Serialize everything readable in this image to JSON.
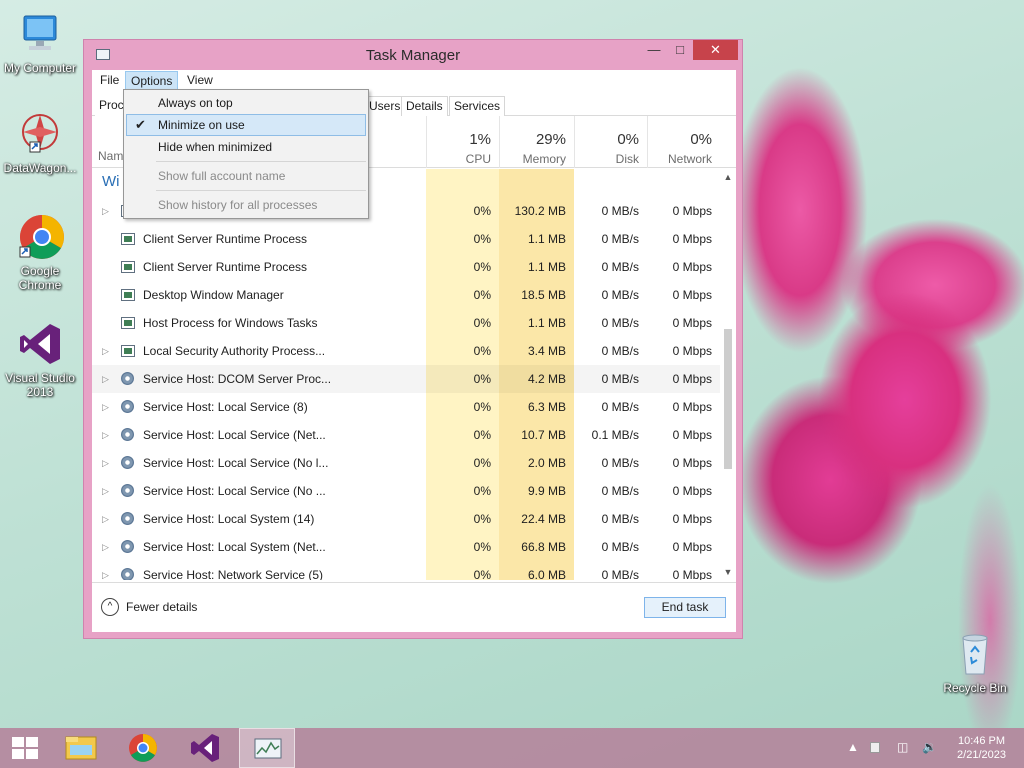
{
  "desktop": {
    "icons": [
      {
        "label": "My Computer"
      },
      {
        "label": "DataWagon..."
      },
      {
        "label": "Google Chrome"
      },
      {
        "label": "Visual Studio 2013"
      },
      {
        "label": "Recycle Bin"
      }
    ]
  },
  "window": {
    "title": "Task Manager",
    "menu": [
      "File",
      "Options",
      "View"
    ],
    "tabs": [
      "Proc",
      "Users",
      "Details",
      "Services"
    ],
    "columns": {
      "name": "Nam",
      "cpu": {
        "pct": "1%",
        "label": "CPU"
      },
      "memory": {
        "pct": "29%",
        "label": "Memory"
      },
      "disk": {
        "pct": "0%",
        "label": "Disk"
      },
      "network": {
        "pct": "0%",
        "label": "Network"
      }
    },
    "group_heading": "Wi",
    "processes": [
      {
        "name": "",
        "cpu": "0%",
        "memory": "130.2 MB",
        "disk": "0 MB/s",
        "network": "0 Mbps"
      },
      {
        "name": "Client Server Runtime Process",
        "cpu": "0%",
        "memory": "1.1 MB",
        "disk": "0 MB/s",
        "network": "0 Mbps"
      },
      {
        "name": "Client Server Runtime Process",
        "cpu": "0%",
        "memory": "1.1 MB",
        "disk": "0 MB/s",
        "network": "0 Mbps"
      },
      {
        "name": "Desktop Window Manager",
        "cpu": "0%",
        "memory": "18.5 MB",
        "disk": "0 MB/s",
        "network": "0 Mbps"
      },
      {
        "name": "Host Process for Windows Tasks",
        "cpu": "0%",
        "memory": "1.1 MB",
        "disk": "0 MB/s",
        "network": "0 Mbps"
      },
      {
        "name": "Local Security Authority Process...",
        "cpu": "0%",
        "memory": "3.4 MB",
        "disk": "0 MB/s",
        "network": "0 Mbps"
      },
      {
        "name": "Service Host: DCOM Server Proc...",
        "cpu": "0%",
        "memory": "4.2 MB",
        "disk": "0 MB/s",
        "network": "0 Mbps"
      },
      {
        "name": "Service Host: Local Service (8)",
        "cpu": "0%",
        "memory": "6.3 MB",
        "disk": "0 MB/s",
        "network": "0 Mbps"
      },
      {
        "name": "Service Host: Local Service (Net...",
        "cpu": "0%",
        "memory": "10.7 MB",
        "disk": "0.1 MB/s",
        "network": "0 Mbps"
      },
      {
        "name": "Service Host: Local Service (No l...",
        "cpu": "0%",
        "memory": "2.0 MB",
        "disk": "0 MB/s",
        "network": "0 Mbps"
      },
      {
        "name": "Service Host: Local Service (No ...",
        "cpu": "0%",
        "memory": "9.9 MB",
        "disk": "0 MB/s",
        "network": "0 Mbps"
      },
      {
        "name": "Service Host: Local System (14)",
        "cpu": "0%",
        "memory": "22.4 MB",
        "disk": "0 MB/s",
        "network": "0 Mbps"
      },
      {
        "name": "Service Host: Local System (Net...",
        "cpu": "0%",
        "memory": "66.8 MB",
        "disk": "0 MB/s",
        "network": "0 Mbps"
      },
      {
        "name": "Service Host: Network Service (5)",
        "cpu": "0%",
        "memory": "6.0 MB",
        "disk": "0 MB/s",
        "network": "0 Mbps"
      }
    ],
    "footer": {
      "fewer_details": "Fewer details",
      "end_task": "End task"
    }
  },
  "options_menu": {
    "items": [
      {
        "label": "Always on top",
        "checked": false,
        "enabled": true
      },
      {
        "label": "Minimize on use",
        "checked": true,
        "enabled": true
      },
      {
        "label": "Hide when minimized",
        "checked": false,
        "enabled": true
      },
      {
        "label": "Show full account name",
        "checked": false,
        "enabled": false
      },
      {
        "label": "Show history for all processes",
        "checked": false,
        "enabled": false
      }
    ]
  },
  "taskbar": {
    "apps": [
      "file-explorer-icon",
      "chrome-icon",
      "visual-studio-icon",
      "task-manager-icon"
    ],
    "clock": {
      "time": "10:46 PM",
      "date": "2/21/2023"
    }
  },
  "colors": {
    "accent": "#e7a2c6",
    "cpu_bg": "#fff4c4",
    "memory_bg": "#fbe7a8",
    "close_button": "#c7434b",
    "group_heading": "#2a6fb5"
  }
}
